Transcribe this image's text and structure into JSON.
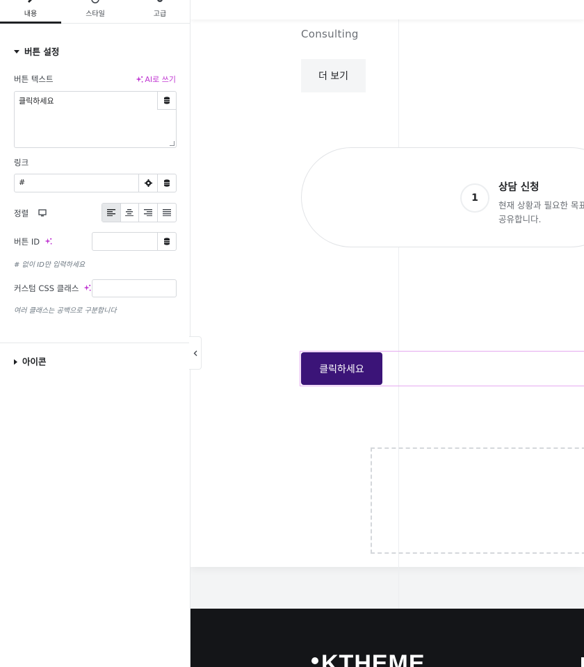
{
  "panel": {
    "tabs": [
      {
        "label": "내용",
        "icon": "pencil-icon",
        "active": true
      },
      {
        "label": "스타일",
        "icon": "style-icon",
        "active": false
      },
      {
        "label": "고급",
        "icon": "gear-icon",
        "active": false
      }
    ],
    "button_section": {
      "title": "버튼 설정",
      "text_label": "버튼 텍스트",
      "ai_write": "AI로 쓰기",
      "text_value": "클릭하세요",
      "link_label": "링크",
      "link_value": "#",
      "align_label": "정렬",
      "id_label": "버튼 ID",
      "id_hint": "# 없이 ID만 입력하세요",
      "css_label": "커스텀 CSS 클래스",
      "css_hint": "여러 클래스는 공백으로 구분합니다"
    },
    "icon_section": {
      "title": "아이콘"
    }
  },
  "canvas": {
    "consulting_text": "Consulting",
    "more_button": "더 보기",
    "step": {
      "number": "1",
      "title": "상담 신청",
      "desc_line1": "현재 상황과 필요한 목표",
      "desc_line2": "공유합니다."
    },
    "cta_button": "클릭하세요",
    "footer_logo": "KTHEME"
  },
  "colors": {
    "accent_purple": "#3b1478",
    "ai_magenta": "#c036d2",
    "selection_outline": "#e5a9f0",
    "footer_bg": "#141518"
  }
}
